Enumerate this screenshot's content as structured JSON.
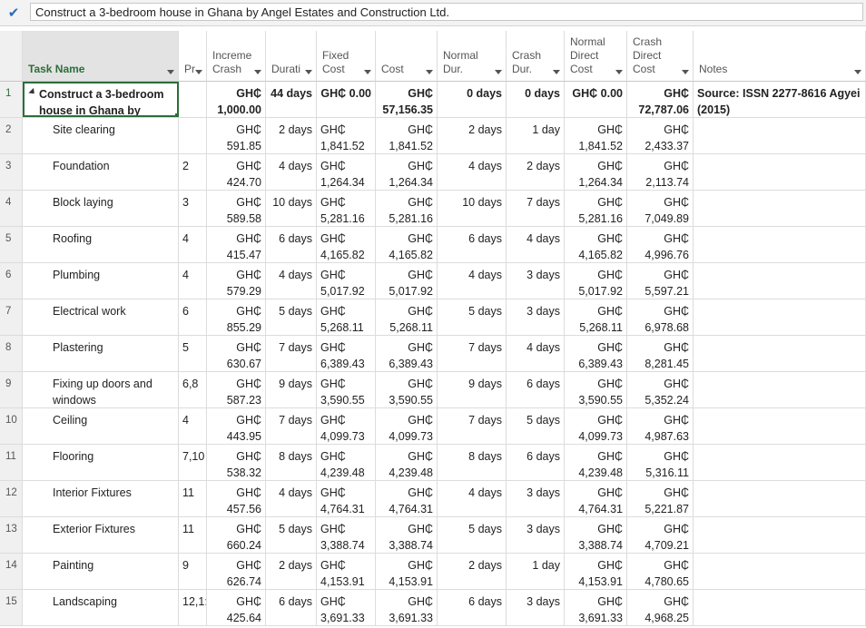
{
  "entry_bar": {
    "value": "Construct a 3-bedroom house in Ghana by Angel Estates and Construction Ltd."
  },
  "columns": [
    {
      "key": "num",
      "label": ""
    },
    {
      "key": "task",
      "label": "Task Name"
    },
    {
      "key": "pred",
      "label": "Pr"
    },
    {
      "key": "inc",
      "label": "Increme\nCrash"
    },
    {
      "key": "dur",
      "label": "Durati"
    },
    {
      "key": "fixed",
      "label": "Fixed\nCost"
    },
    {
      "key": "cost",
      "label": "Cost"
    },
    {
      "key": "ndur",
      "label": "Normal\nDur."
    },
    {
      "key": "cdur",
      "label": "Crash\nDur."
    },
    {
      "key": "ndc",
      "label": "Normal\nDirect\nCost"
    },
    {
      "key": "cdc",
      "label": "Crash\nDirect\nCost"
    },
    {
      "key": "notes",
      "label": "Notes"
    }
  ],
  "rows": [
    {
      "num": "1",
      "task": "Construct a 3-bedroom\nhouse in Ghana by",
      "pred": "",
      "inc": "GH₵\n1,000.00",
      "dur": "44 days",
      "fixed": "GH₵ 0.00",
      "cost": "GH₵\n57,156.35",
      "ndur": "0 days",
      "cdur": "0 days",
      "ndc": "GH₵ 0.00",
      "cdc": "GH₵\n72,787.06",
      "notes": "Source: ISSN 2277-8616 Agyei\n(2015)"
    },
    {
      "num": "2",
      "task": "Site clearing",
      "pred": "",
      "inc": "GH₵\n591.85",
      "dur": "2 days",
      "fixed": "GH₵\n1,841.52",
      "cost": "GH₵\n1,841.52",
      "ndur": "2 days",
      "cdur": "1 day",
      "ndc": "GH₵\n1,841.52",
      "cdc": "GH₵\n2,433.37",
      "notes": ""
    },
    {
      "num": "3",
      "task": "Foundation",
      "pred": "2",
      "inc": "GH₵\n424.70",
      "dur": "4 days",
      "fixed": "GH₵\n1,264.34",
      "cost": "GH₵\n1,264.34",
      "ndur": "4 days",
      "cdur": "2 days",
      "ndc": "GH₵\n1,264.34",
      "cdc": "GH₵\n2,113.74",
      "notes": ""
    },
    {
      "num": "4",
      "task": "Block laying",
      "pred": "3",
      "inc": "GH₵\n589.58",
      "dur": "10 days",
      "fixed": "GH₵\n5,281.16",
      "cost": "GH₵\n5,281.16",
      "ndur": "10 days",
      "cdur": "7 days",
      "ndc": "GH₵\n5,281.16",
      "cdc": "GH₵\n7,049.89",
      "notes": ""
    },
    {
      "num": "5",
      "task": "Roofing",
      "pred": "4",
      "inc": "GH₵\n415.47",
      "dur": "6 days",
      "fixed": "GH₵\n4,165.82",
      "cost": "GH₵\n4,165.82",
      "ndur": "6 days",
      "cdur": "4 days",
      "ndc": "GH₵\n4,165.82",
      "cdc": "GH₵\n4,996.76",
      "notes": ""
    },
    {
      "num": "6",
      "task": "Plumbing",
      "pred": "4",
      "inc": "GH₵\n579.29",
      "dur": "4 days",
      "fixed": "GH₵\n5,017.92",
      "cost": "GH₵\n5,017.92",
      "ndur": "4 days",
      "cdur": "3 days",
      "ndc": "GH₵\n5,017.92",
      "cdc": "GH₵\n5,597.21",
      "notes": ""
    },
    {
      "num": "7",
      "task": "Electrical work",
      "pred": "6",
      "inc": "GH₵\n855.29",
      "dur": "5 days",
      "fixed": "GH₵\n5,268.11",
      "cost": "GH₵\n5,268.11",
      "ndur": "5 days",
      "cdur": "3 days",
      "ndc": "GH₵\n5,268.11",
      "cdc": "GH₵\n6,978.68",
      "notes": ""
    },
    {
      "num": "8",
      "task": "Plastering",
      "pred": "5",
      "inc": "GH₵\n630.67",
      "dur": "7 days",
      "fixed": "GH₵\n6,389.43",
      "cost": "GH₵\n6,389.43",
      "ndur": "7 days",
      "cdur": "4 days",
      "ndc": "GH₵\n6,389.43",
      "cdc": "GH₵\n8,281.45",
      "notes": ""
    },
    {
      "num": "9",
      "task": "Fixing up doors and\nwindows",
      "pred": "6,8",
      "inc": "GH₵\n587.23",
      "dur": "9 days",
      "fixed": "GH₵\n3,590.55",
      "cost": "GH₵\n3,590.55",
      "ndur": "9 days",
      "cdur": "6 days",
      "ndc": "GH₵\n3,590.55",
      "cdc": "GH₵\n5,352.24",
      "notes": ""
    },
    {
      "num": "10",
      "task": "Ceiling",
      "pred": "4",
      "inc": "GH₵\n443.95",
      "dur": "7 days",
      "fixed": "GH₵\n4,099.73",
      "cost": "GH₵\n4,099.73",
      "ndur": "7 days",
      "cdur": "5 days",
      "ndc": "GH₵\n4,099.73",
      "cdc": "GH₵\n4,987.63",
      "notes": ""
    },
    {
      "num": "11",
      "task": "Flooring",
      "pred": "7,10",
      "inc": "GH₵\n538.32",
      "dur": "8 days",
      "fixed": "GH₵\n4,239.48",
      "cost": "GH₵\n4,239.48",
      "ndur": "8 days",
      "cdur": "6 days",
      "ndc": "GH₵\n4,239.48",
      "cdc": "GH₵\n5,316.11",
      "notes": ""
    },
    {
      "num": "12",
      "task": "Interior Fixtures",
      "pred": "11",
      "inc": "GH₵\n457.56",
      "dur": "4 days",
      "fixed": "GH₵\n4,764.31",
      "cost": "GH₵\n4,764.31",
      "ndur": "4 days",
      "cdur": "3 days",
      "ndc": "GH₵\n4,764.31",
      "cdc": "GH₵\n5,221.87",
      "notes": ""
    },
    {
      "num": "13",
      "task": "Exterior Fixtures",
      "pred": "11",
      "inc": "GH₵\n660.24",
      "dur": "5 days",
      "fixed": "GH₵\n3,388.74",
      "cost": "GH₵\n3,388.74",
      "ndur": "5 days",
      "cdur": "3 days",
      "ndc": "GH₵\n3,388.74",
      "cdc": "GH₵\n4,709.21",
      "notes": ""
    },
    {
      "num": "14",
      "task": "Painting",
      "pred": "9",
      "inc": "GH₵\n626.74",
      "dur": "2 days",
      "fixed": "GH₵\n4,153.91",
      "cost": "GH₵\n4,153.91",
      "ndur": "2 days",
      "cdur": "1 day",
      "ndc": "GH₵\n4,153.91",
      "cdc": "GH₵\n4,780.65",
      "notes": ""
    },
    {
      "num": "15",
      "task": "Landscaping",
      "pred": "12,1:",
      "inc": "GH₵\n425.64",
      "dur": "6 days",
      "fixed": "GH₵\n3,691.33",
      "cost": "GH₵\n3,691.33",
      "ndur": "6 days",
      "cdur": "3 days",
      "ndc": "GH₵\n3,691.33",
      "cdc": "GH₵\n4,968.25",
      "notes": ""
    }
  ]
}
